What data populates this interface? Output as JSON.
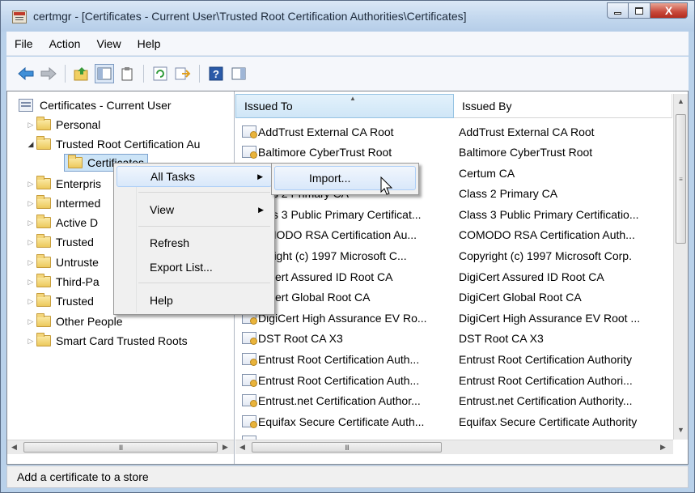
{
  "window": {
    "title": "certmgr - [Certificates - Current User\\Trusted Root Certification Authorities\\Certificates]",
    "minimize": "minimize",
    "maximize": "maximize",
    "close": "X"
  },
  "menubar": [
    "File",
    "Action",
    "View",
    "Help"
  ],
  "toolbar": {
    "icons": [
      "back-arrow-icon",
      "forward-arrow-icon",
      "up-folder-icon",
      "show-hide-tree-icon",
      "properties-icon",
      "refresh-icon",
      "export-list-icon",
      "help-icon",
      "show-action-pane-icon"
    ]
  },
  "tree": {
    "root": "Certificates - Current User",
    "items": [
      "Personal",
      "Trusted Root Certification Au",
      "Certificates",
      "Enterpris",
      "Intermed",
      "Active D",
      "Trusted",
      "Untruste",
      "Third-Pa",
      "Trusted",
      "Other People",
      "Smart Card Trusted Roots"
    ],
    "scroll_glyph": "III"
  },
  "list": {
    "columns": [
      "Issued To",
      "Issued By"
    ],
    "rows": [
      [
        "AddTrust External CA Root",
        "AddTrust External CA Root"
      ],
      [
        "Baltimore CyberTrust Root",
        "Baltimore CyberTrust Root"
      ],
      [
        "",
        "Certum CA"
      ],
      [
        "lass 2 Primary CA",
        "Class 2 Primary CA"
      ],
      [
        "lass 3 Public Primary Certificat...",
        "Class 3 Public Primary Certificatio..."
      ],
      [
        "OMODO RSA Certification Au...",
        "COMODO RSA Certification Auth..."
      ],
      [
        "pyright (c) 1997 Microsoft C...",
        "Copyright (c) 1997 Microsoft Corp."
      ],
      [
        "giCert Assured ID Root CA",
        "DigiCert Assured ID Root CA"
      ],
      [
        "giCert Global Root CA",
        "DigiCert Global Root CA"
      ],
      [
        "DigiCert High Assurance EV Ro...",
        "DigiCert High Assurance EV Root ..."
      ],
      [
        "DST Root CA X3",
        "DST Root CA X3"
      ],
      [
        "Entrust Root Certification Auth...",
        "Entrust Root Certification Authority"
      ],
      [
        "Entrust Root Certification Auth...",
        "Entrust Root Certification Authori..."
      ],
      [
        "Entrust.net Certification Author...",
        "Entrust.net Certification Authority..."
      ],
      [
        "Equifax Secure Certificate Auth...",
        "Equifax Secure Certificate Authority"
      ]
    ],
    "scroll_glyph": "III"
  },
  "context_menu": {
    "items": [
      "All Tasks",
      "View",
      "Refresh",
      "Export List...",
      "Help"
    ]
  },
  "submenu": {
    "items": [
      "Import..."
    ]
  },
  "status": "Add a certificate to a store"
}
